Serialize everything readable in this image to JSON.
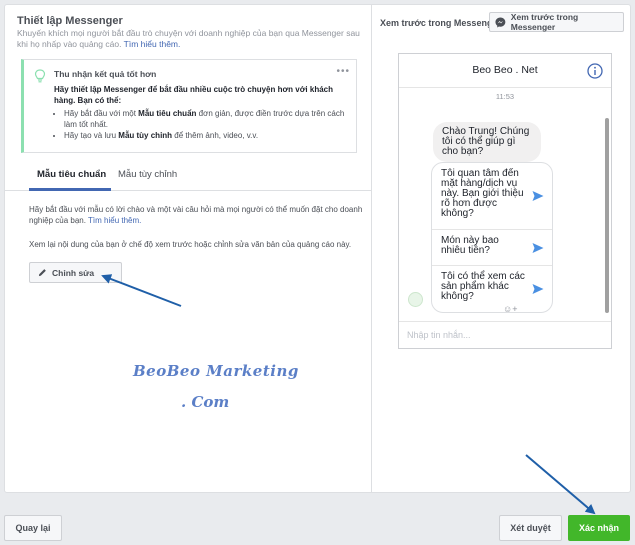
{
  "setup": {
    "title": "Thiết lập Messenger",
    "subtitle": "Khuyến khích mọi người bắt đầu trò chuyện với doanh nghiệp của bạn qua Messenger sau khi họ nhấp vào quảng cáo.",
    "learn_more": "Tìm hiểu thêm."
  },
  "tip": {
    "heading": "Thu nhận kết quả tốt hơn",
    "dots": "•••",
    "intro": "Hãy thiết lập Messenger để bắt đầu nhiều cuộc trò chuyện hơn với khách hàng. Bạn có thể:",
    "bullet1_pre": "Hãy bắt đầu với một ",
    "bullet1_bold": "Mẫu tiêu chuẩn",
    "bullet1_post": " đơn giản, được điền trước dựa trên cách làm tốt nhất.",
    "bullet2_pre": "Hãy tạo và lưu ",
    "bullet2_bold": "Mẫu tùy chỉnh",
    "bullet2_post": " để thêm ảnh, video, v.v."
  },
  "tabs": {
    "standard": "Mẫu tiêu chuẩn",
    "custom": "Mẫu tùy chỉnh"
  },
  "content": {
    "desc1": "Hãy bắt đầu với mẫu có lời chào và một vài câu hỏi mà mọi người có thể muốn đặt cho doanh nghiệp của bạn.",
    "desc1_link": "Tìm hiểu thêm.",
    "desc2": "Xem lại nội dung của bạn ở chế độ xem trước hoặc chỉnh sửa văn bản của quảng cáo này.",
    "edit_button": "Chỉnh sửa"
  },
  "watermark": {
    "line1": "BeoBeo Marketing",
    "line2": ". Com"
  },
  "preview": {
    "label": "Xem trước trong Messenger",
    "button": "Xem trước trong Messenger",
    "page_name": "Beo Beo . Net",
    "time": "11:53",
    "greeting": "Chào Trung! Chúng tôi có thể giúp gì cho bạn?",
    "questions": [
      "Tôi quan tâm đến mặt hàng/dịch vụ này. Bạn giới thiệu rõ hơn được không?",
      "Món này bao nhiêu tiền?",
      "Tôi có thể xem các sản phẩm khác không?"
    ],
    "composer_placeholder": "Nhập tin nhắn..."
  },
  "footer": {
    "back": "Quay lại",
    "review": "Xét duyệt",
    "confirm": "Xác nhận"
  },
  "colors": {
    "accent": "#4267b2",
    "confirm_green": "#42b72a",
    "tip_border": "#8ce0b0",
    "arrow": "#1f5fa8"
  }
}
